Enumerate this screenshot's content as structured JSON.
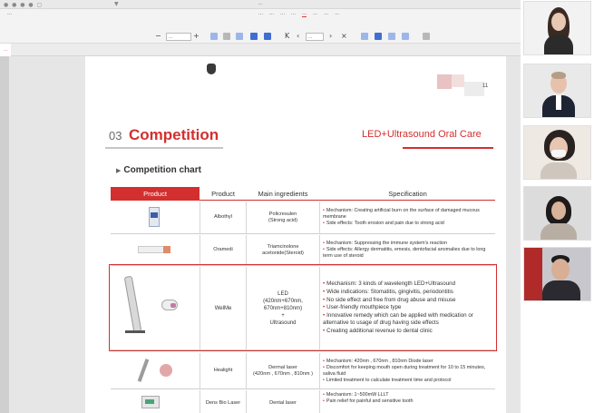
{
  "window": {
    "title": "...",
    "tab_label": "...",
    "left_menu": "...",
    "menus": [
      "...",
      "...",
      "...",
      "...",
      "...",
      "...",
      "...",
      "..."
    ],
    "zoom_value": "...",
    "page_field": "..."
  },
  "slide": {
    "page_number": "11",
    "section_number": "03",
    "section_title": "Competition",
    "brand_subtitle": "LED+Ultrasound Oral Care",
    "chart_heading": "Competition chart",
    "columns": [
      "Product",
      "Product",
      "Main ingredients",
      "Specification"
    ],
    "rows": [
      {
        "name": "Albothyl",
        "ingredient": "Policresulen\n(Strong acid)",
        "spec": [
          "Mechanism: Creating artificial burn on the surface of damaged mucous membrane",
          "Side effects: Tooth erosion and pain due to strong acid"
        ]
      },
      {
        "name": "Oramedi",
        "ingredient": "Triamcinolone\nacetonide(Steroid)",
        "spec": [
          "Mechanism: Suppressing the immune system's reaction",
          "Side effects: Allergy dermatitis, emesis, dentofacial anomalies due to long term use of steroid"
        ]
      },
      {
        "name": "WelMe",
        "ingredient": "LED\n(420nm+670nm,\n670nm+810nm)\n+\nUltrasound",
        "spec": [
          "Mechanism: 3 kinds of wavelength LED+Ultrasound",
          "Wide indications: Stomatitis, gingivitis, periodontitis",
          "No side effect and free from drug abuse and misuse",
          "User-friendly mouthpiece type",
          "Innovative remedy which can be applied with medication or alternative to usage of drug having side effects",
          "Creating additional revenue to dental clinic"
        ]
      },
      {
        "name": "Healight",
        "ingredient": "Dermal laser\n(420nm , 670nm , 810nm )",
        "spec": [
          "Mechanism: 420nm , 670nm , 810nm Diode laser",
          "Discomfort for keeping mouth open during treatment for 10 to 15 minutes, saliva fluid",
          "Limited treatment to calculate treatment time and protocol"
        ]
      },
      {
        "name": "Dens Bio Laser",
        "ingredient": "Dental laser",
        "spec": [
          "Mechanism: 1~500mW LLLT",
          "Pain relief for painful and sensitive tooth"
        ]
      }
    ]
  },
  "participants": [
    {
      "role": "participant-1"
    },
    {
      "role": "participant-2"
    },
    {
      "role": "participant-3"
    },
    {
      "role": "participant-4"
    },
    {
      "role": "participant-5"
    }
  ],
  "colors": {
    "accent_red": "#d32f2f",
    "toolbar_blue": "#3f6fd3"
  }
}
